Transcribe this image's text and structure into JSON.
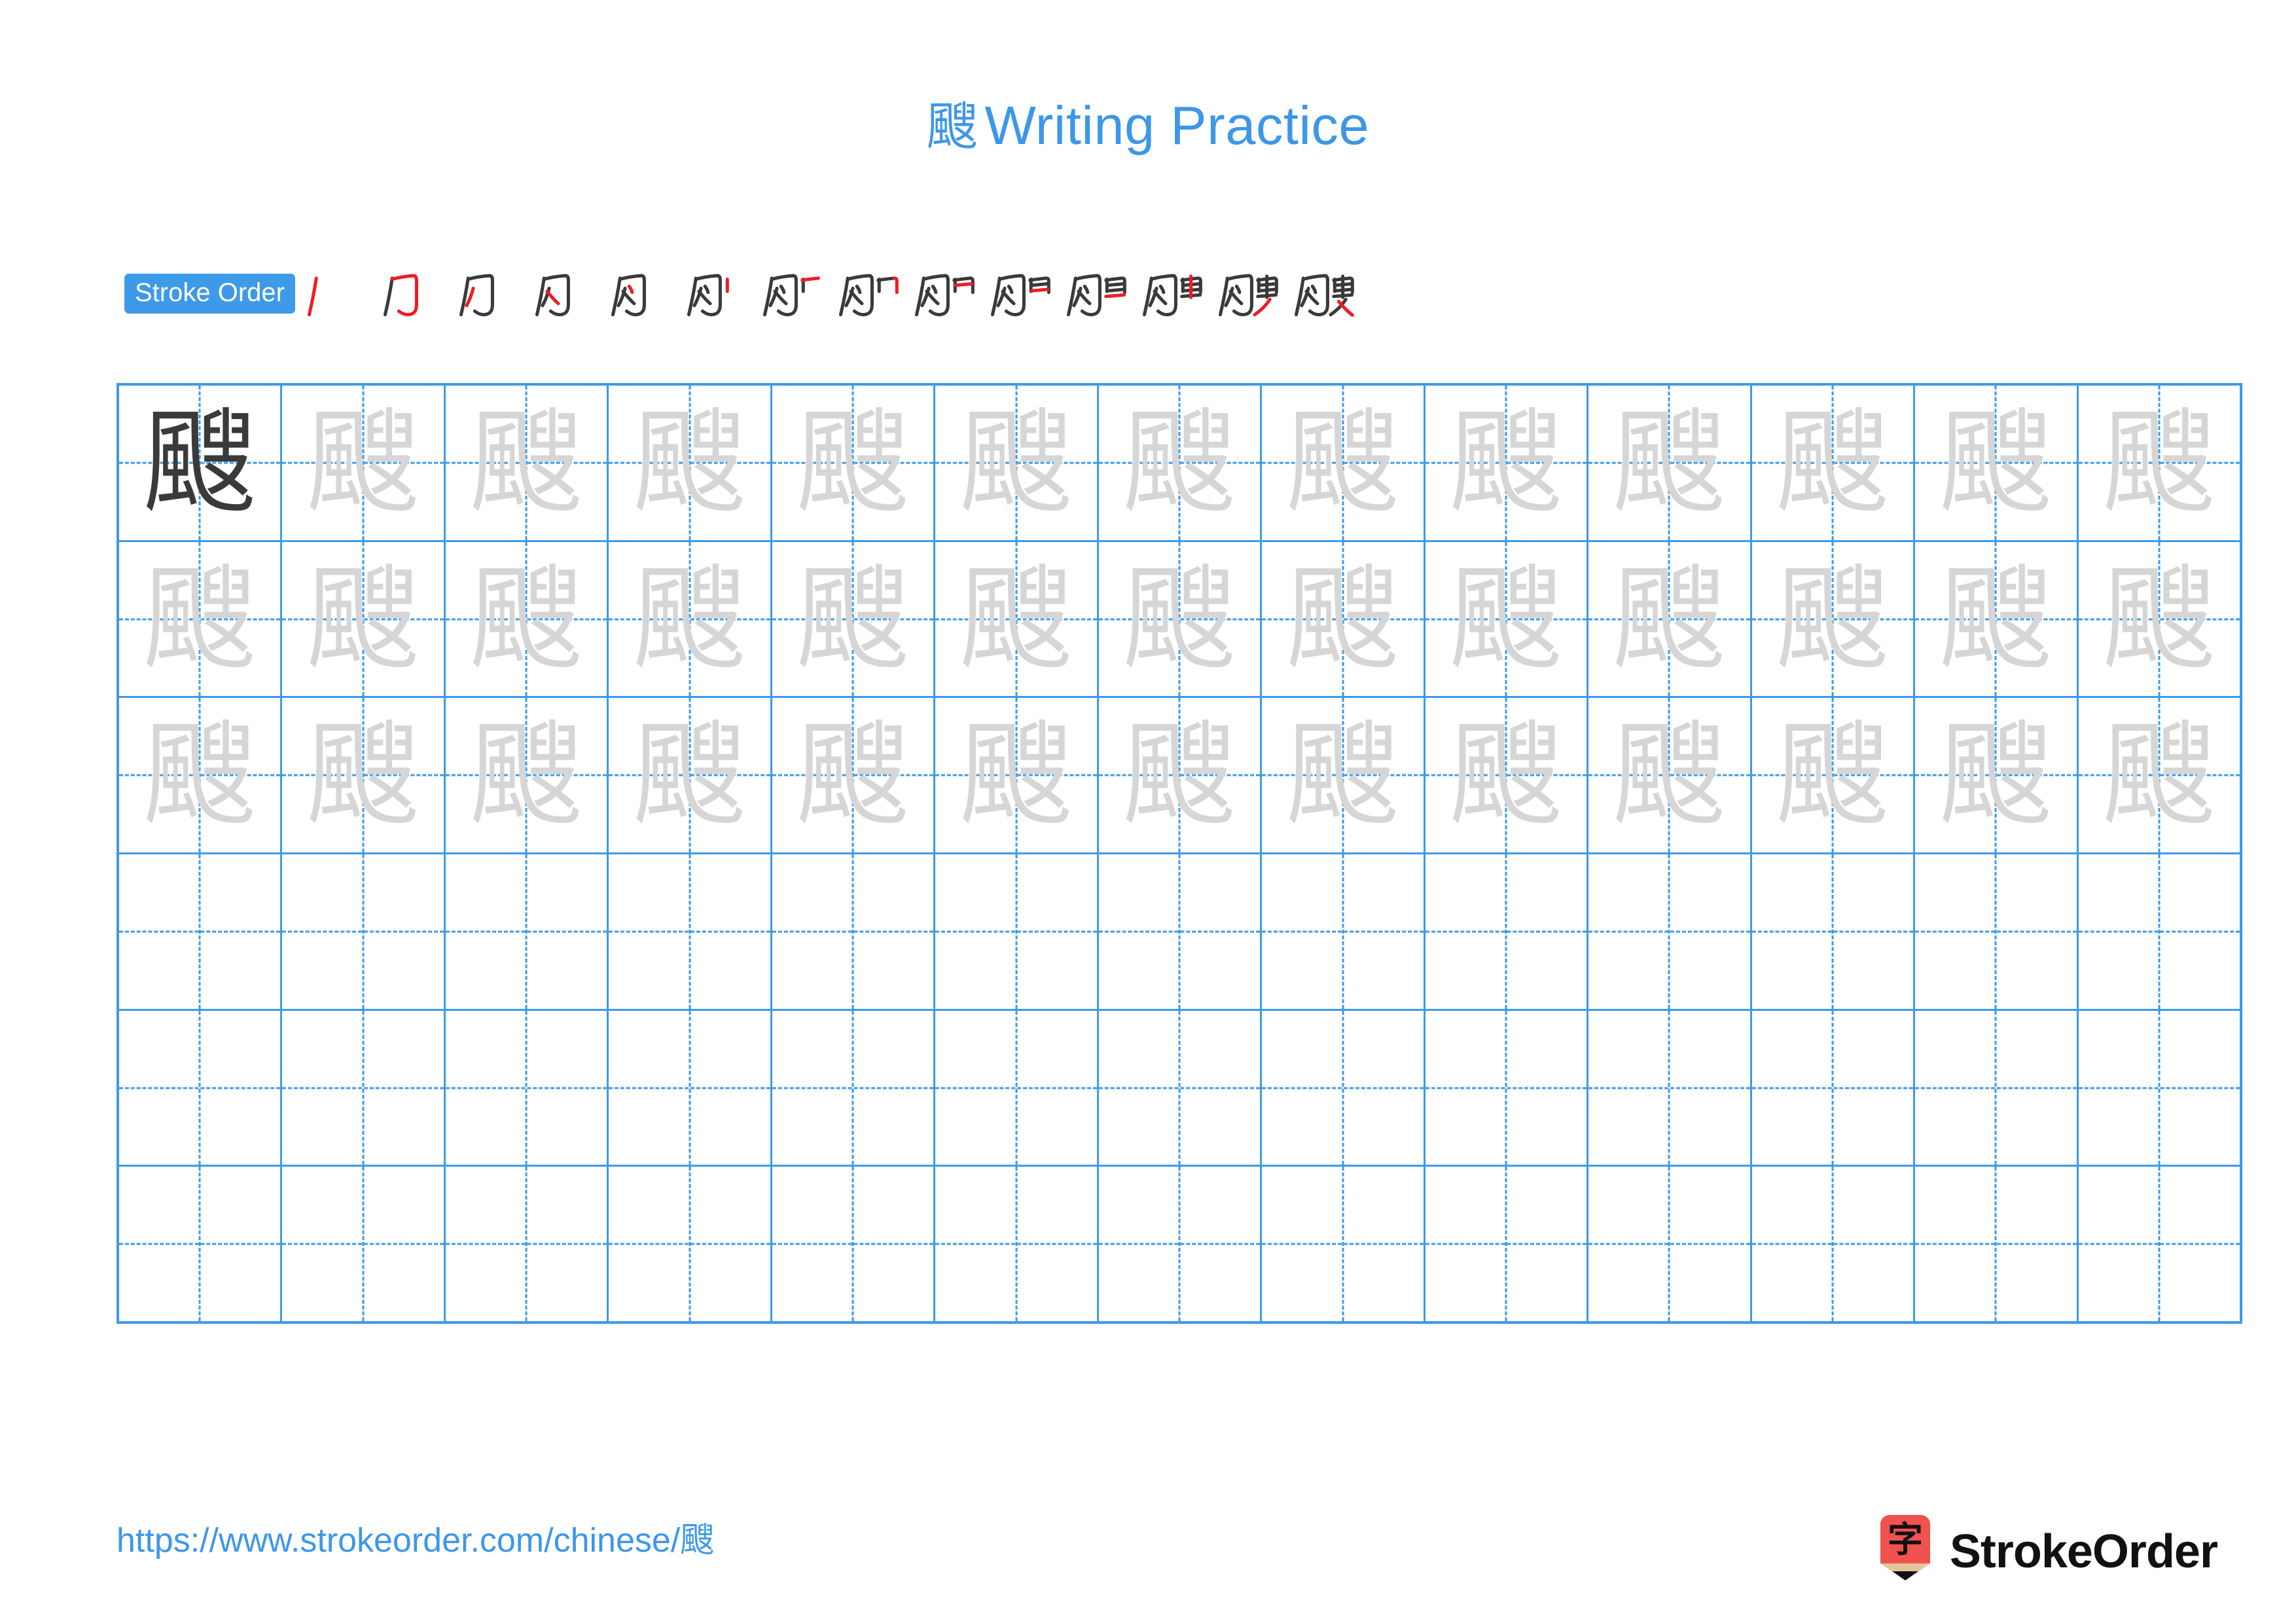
{
  "header": {
    "character": "颼",
    "title_suffix": "Writing Practice"
  },
  "stroke_order": {
    "badge_label": "Stroke Order",
    "character": "颼",
    "total_strokes": 14,
    "new_stroke_color": "#ee1c25",
    "drawn_stroke_color": "#3a3a3a",
    "steps": [
      {
        "index": 1,
        "new_stroke": "丿"
      },
      {
        "index": 2,
        "new_stroke": "㇈"
      },
      {
        "index": 3,
        "new_stroke": "丿"
      },
      {
        "index": 4,
        "new_stroke": "㇒"
      },
      {
        "index": 5,
        "new_stroke": "丶"
      },
      {
        "index": 6,
        "new_stroke": "丨"
      },
      {
        "index": 7,
        "new_stroke": "一"
      },
      {
        "index": 8,
        "new_stroke": "㇕"
      },
      {
        "index": 9,
        "new_stroke": "一"
      },
      {
        "index": 10,
        "new_stroke": "一"
      },
      {
        "index": 11,
        "new_stroke": "一"
      },
      {
        "index": 12,
        "new_stroke": "丨"
      },
      {
        "index": 13,
        "new_stroke": "㇏"
      },
      {
        "index": 14,
        "new_stroke": "㇔"
      }
    ]
  },
  "practice_grid": {
    "columns": 13,
    "rows": 6,
    "grid_line_color": "#3d9ae8",
    "dark_char_color": "#3a3a3a",
    "trace_char_color": "#d6d6d6",
    "cells": [
      [
        "dark",
        "trace",
        "trace",
        "trace",
        "trace",
        "trace",
        "trace",
        "trace",
        "trace",
        "trace",
        "trace",
        "trace",
        "trace"
      ],
      [
        "trace",
        "trace",
        "trace",
        "trace",
        "trace",
        "trace",
        "trace",
        "trace",
        "trace",
        "trace",
        "trace",
        "trace",
        "trace"
      ],
      [
        "trace",
        "trace",
        "trace",
        "trace",
        "trace",
        "trace",
        "trace",
        "trace",
        "trace",
        "trace",
        "trace",
        "trace",
        "trace"
      ],
      [
        "blank",
        "blank",
        "blank",
        "blank",
        "blank",
        "blank",
        "blank",
        "blank",
        "blank",
        "blank",
        "blank",
        "blank",
        "blank"
      ],
      [
        "blank",
        "blank",
        "blank",
        "blank",
        "blank",
        "blank",
        "blank",
        "blank",
        "blank",
        "blank",
        "blank",
        "blank",
        "blank"
      ],
      [
        "blank",
        "blank",
        "blank",
        "blank",
        "blank",
        "blank",
        "blank",
        "blank",
        "blank",
        "blank",
        "blank",
        "blank",
        "blank"
      ]
    ]
  },
  "footer": {
    "url_prefix": "https://www.strokeorder.com/chinese/",
    "url_character": "颼",
    "brand_name": "StrokeOrder",
    "brand_logo_char": "字",
    "brand_logo_color": "#f0524f",
    "brand_logo_wood_color": "#e3c49c",
    "brand_logo_tip_color": "#111111"
  }
}
